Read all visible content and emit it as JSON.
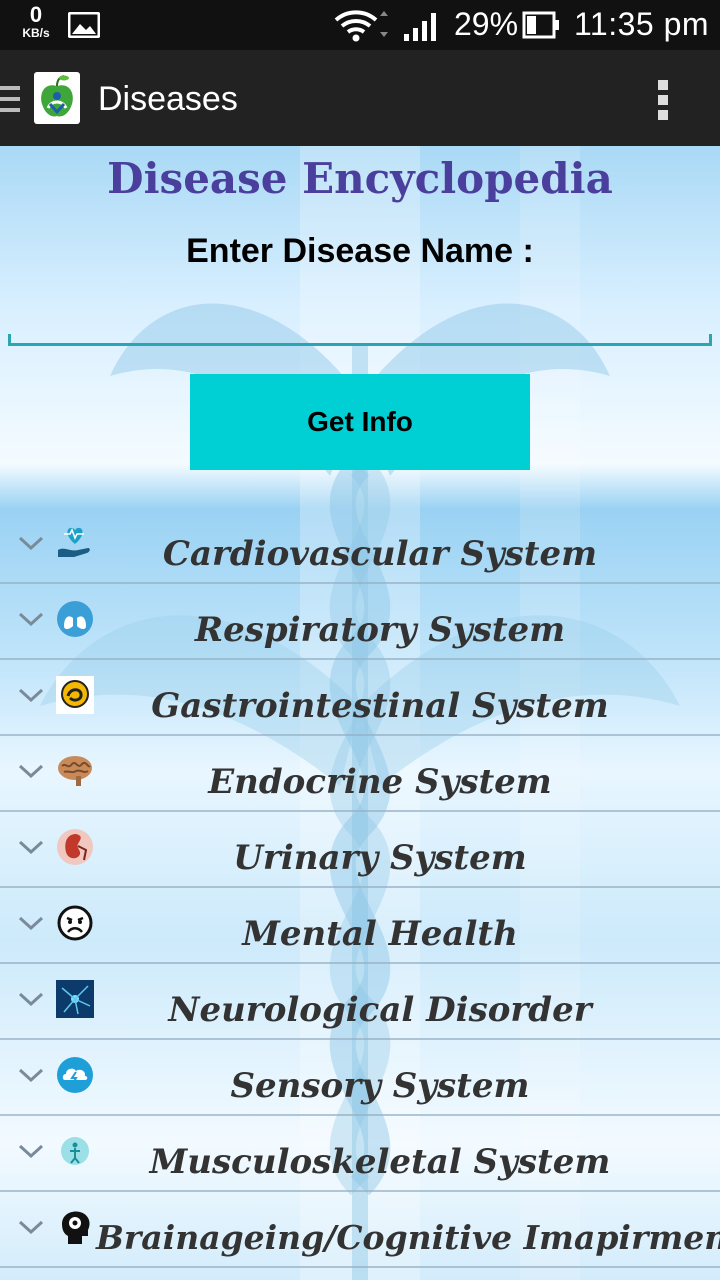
{
  "status_bar": {
    "net_speed": "0",
    "net_unit": "KB/s",
    "battery_percent": "29%",
    "time": "11:35 pm"
  },
  "action_bar": {
    "title": "Diseases",
    "icons": [
      "drawer-icon",
      "app-logo",
      "overflow-menu-icon"
    ]
  },
  "main": {
    "heading": "Disease Encyclopedia",
    "search_label": "Enter Disease Name :",
    "search_value": "",
    "button_label": "Get Info"
  },
  "categories": [
    {
      "label": "Cardiovascular System",
      "icon": "heart-hand-icon"
    },
    {
      "label": "Respiratory System",
      "icon": "lungs-icon"
    },
    {
      "label": "Gastrointestinal System",
      "icon": "stomach-icon"
    },
    {
      "label": "Endocrine System",
      "icon": "brain-icon"
    },
    {
      "label": "Urinary System",
      "icon": "kidney-icon"
    },
    {
      "label": "Mental Health",
      "icon": "sad-face-icon"
    },
    {
      "label": "Neurological Disorder",
      "icon": "neuron-icon"
    },
    {
      "label": "Sensory System",
      "icon": "sensory-icon"
    },
    {
      "label": "Musculoskeletal System",
      "icon": "musculoskeletal-icon"
    },
    {
      "label": "Brainageing/Cognitive Imapirment",
      "icon": "head-gears-icon"
    }
  ],
  "colors": {
    "heading": "#4a3f9c",
    "button": "#00cfd4",
    "input_underline": "#2aa6b2"
  }
}
